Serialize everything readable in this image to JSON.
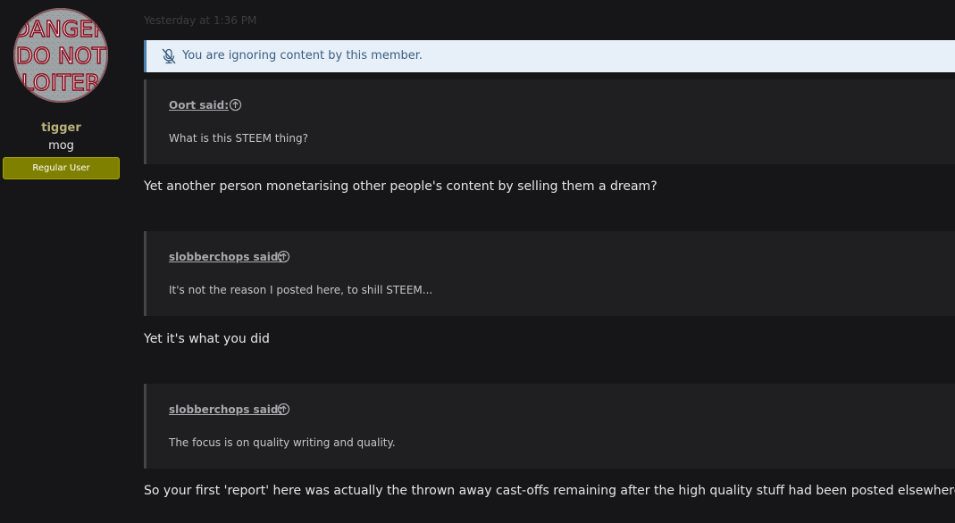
{
  "user": {
    "username": "tigger",
    "title": "mog",
    "banner": "Regular User",
    "avatar_text": [
      "DANGER",
      "DO NOT",
      "LOITER"
    ]
  },
  "post": {
    "date": "Yesterday at 1:36 PM",
    "ignore_notice": "You are ignoring content by this member.",
    "quotes": [
      {
        "author": "Oort said:",
        "text": "What is this STEEM thing?"
      },
      {
        "author": "slobberchops said:",
        "text": "It's not the reason I posted here, to shill STEEM..."
      },
      {
        "author": "slobberchops said:",
        "text": "The focus is on quality writing and quality."
      }
    ],
    "replies": [
      "Yet another person monetarising other people's content by selling them a dream?",
      "Yet it's what you did",
      "So your first 'report' here was actually the thrown away cast-offs remaining after the high quality stuff had been posted elsewhere?"
    ]
  },
  "colors": {
    "background": "#161618",
    "username": "#b8b17a",
    "banner": "#808000",
    "notice_bg": "#e7f0f9",
    "notice_text": "#3a5d80"
  },
  "icons": {
    "notice": "muted-microphone-icon",
    "quote_jump": "arrow-circle-up-icon"
  }
}
